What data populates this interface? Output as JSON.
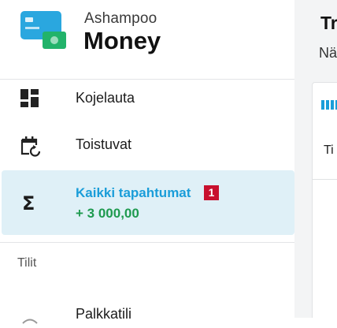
{
  "brand": {
    "small": "Ashampoo",
    "big": "Money"
  },
  "nav": {
    "items": [
      {
        "label": "Kojelauta",
        "icon": "dashboard-icon"
      },
      {
        "label": "Toistuvat",
        "icon": "recurring-calendar-icon"
      }
    ],
    "active": {
      "label": "Kaikki tapahtumat",
      "badge": "1",
      "amount": "+ 3 000,00",
      "icon": "sigma-icon"
    }
  },
  "accounts": {
    "section_label": "Tilit",
    "items": [
      {
        "label": "Palkkatili",
        "icon": "account-icon"
      }
    ]
  },
  "main": {
    "title": "Tr",
    "subtitle": "Nä",
    "card_header": "Ti"
  },
  "colors": {
    "accent": "#1a9dd9",
    "active_bg": "#dff0f7",
    "positive": "#1e9a4f",
    "badge": "#c8102e"
  }
}
